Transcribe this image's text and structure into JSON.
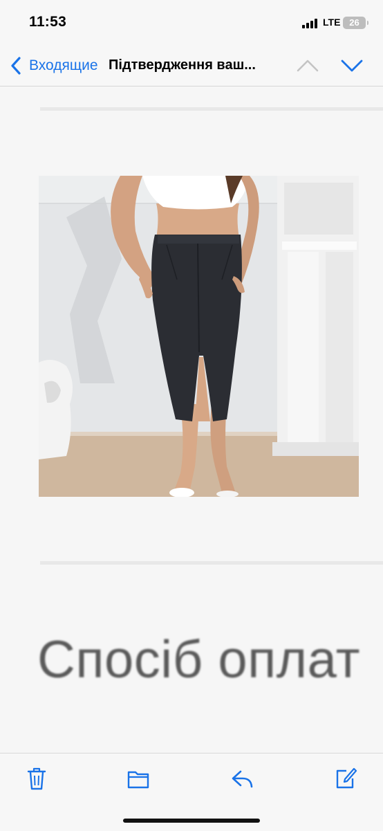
{
  "status_bar": {
    "time": "11:53",
    "network": "LTE",
    "battery": "26"
  },
  "nav": {
    "back_label": "Входящие",
    "subject": "Підтвердження ваш..."
  },
  "content": {
    "payment_heading": "Спосіб оплат"
  },
  "colors": {
    "accent": "#1a73e8",
    "background": "#f6f6f6"
  },
  "toolbar": {
    "icons": [
      "trash-icon",
      "folder-icon",
      "reply-icon",
      "compose-icon"
    ]
  }
}
